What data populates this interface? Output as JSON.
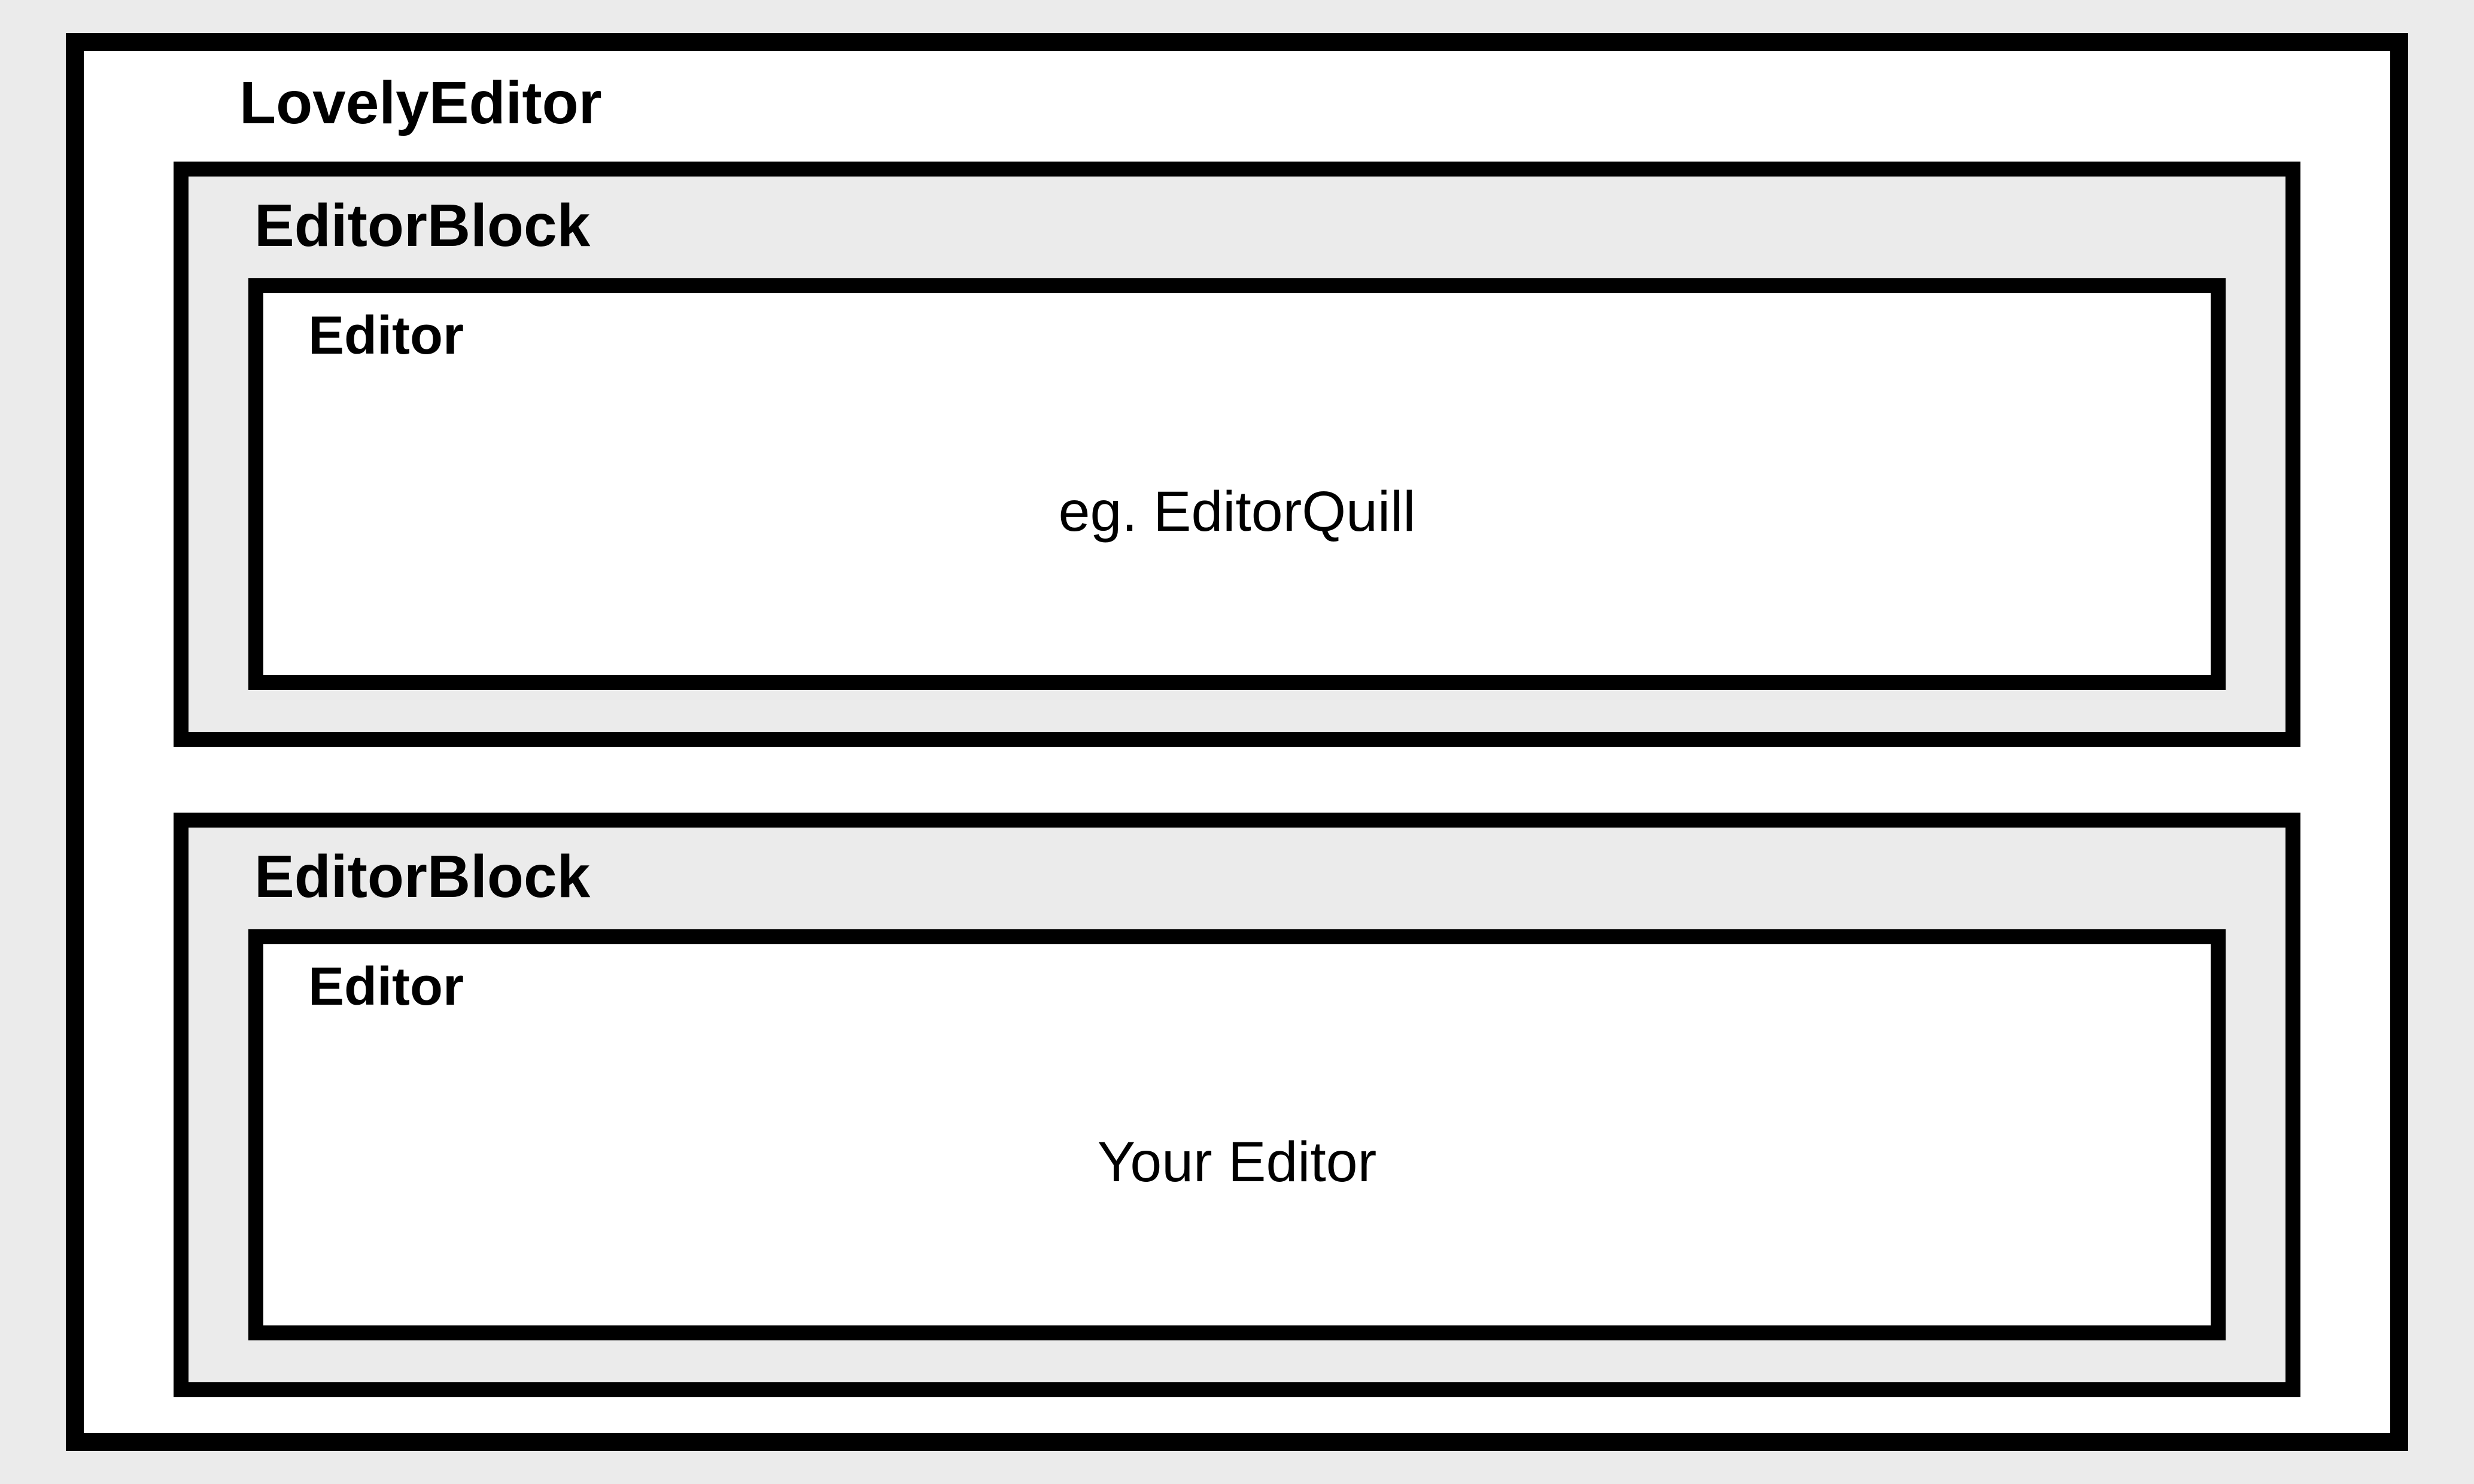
{
  "diagram": {
    "title": "LovelyEditor",
    "blocks": [
      {
        "title": "EditorBlock",
        "editor": {
          "title": "Editor",
          "content": "eg. EditorQuill"
        }
      },
      {
        "title": "EditorBlock",
        "editor": {
          "title": "Editor",
          "content": "Your Editor"
        }
      }
    ]
  }
}
